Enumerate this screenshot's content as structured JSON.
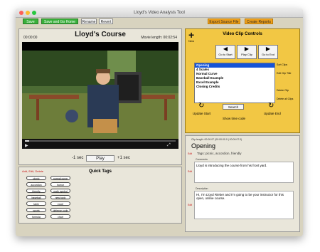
{
  "window": {
    "title": "Lloyd's Video Analysis Tool"
  },
  "toolbar": {
    "save": "Save",
    "save_go_home": "Save and Go Home",
    "rename": "Rename",
    "revert": "Revert",
    "export_source": "Export Source File",
    "create_reports": "Create Reports"
  },
  "video": {
    "timestamp": "00:00:00",
    "course_title": "Lloyd's Course",
    "movie_length": "Movie length: 00:02:54",
    "minus": "-1 sec",
    "play": "Play",
    "plus": "+1 sec"
  },
  "tags": {
    "edit_label": "Add, Edit, Delete",
    "header": "Quick Tags",
    "items": [
      "picnic",
      "normal curve",
      "accordion",
      "humor",
      "friendly",
      "math symbol",
      "baseball",
      "new topic",
      "table",
      "excel",
      "sports",
      "defense code",
      "formula",
      "chart"
    ]
  },
  "clip": {
    "new_plus": "+",
    "new_label": "New",
    "header": "Video Clip Controls",
    "go_start": "Go to Start",
    "play_clip": "Play Clip",
    "go_end": "Go to End",
    "items": [
      "Opening",
      "4 Scales",
      "Normal Curve",
      "Baseball Example",
      "Excel Example",
      "Closing Credits"
    ],
    "sort_clips": "Sort Clips",
    "edit_clip_title": "Edit Clip Title",
    "delete_clip": "Delete Clip",
    "delete_all_clips": "Delete all Clips",
    "search": "Search",
    "update_start": "Update Start",
    "update_end": "Update End",
    "show_time": "Show time code"
  },
  "details": {
    "clip_length": "Clip length: 00:00:07 (00:00:00.0 | 00:00:07.0)",
    "title": "Opening",
    "edit1": "Edit",
    "tags_line": "Tags: picnic, accordion, friendly",
    "edit2": "Edit",
    "comments_label": "Comments",
    "comments": "Lloyd is introducing the course from his front yard.",
    "edit3": "Edit",
    "description_label": "Description",
    "description": "Hi, I'm Lloyd Rieber and I'm going to be your instructor for this open, online course."
  },
  "colors": {
    "window_bg": "#d8d3bf",
    "green_button": "#38b03a",
    "orange_button": "#f2a21b",
    "clip_panel": "#f2c744",
    "selected_item": "#1554d8",
    "edit_red": "#c81010"
  }
}
